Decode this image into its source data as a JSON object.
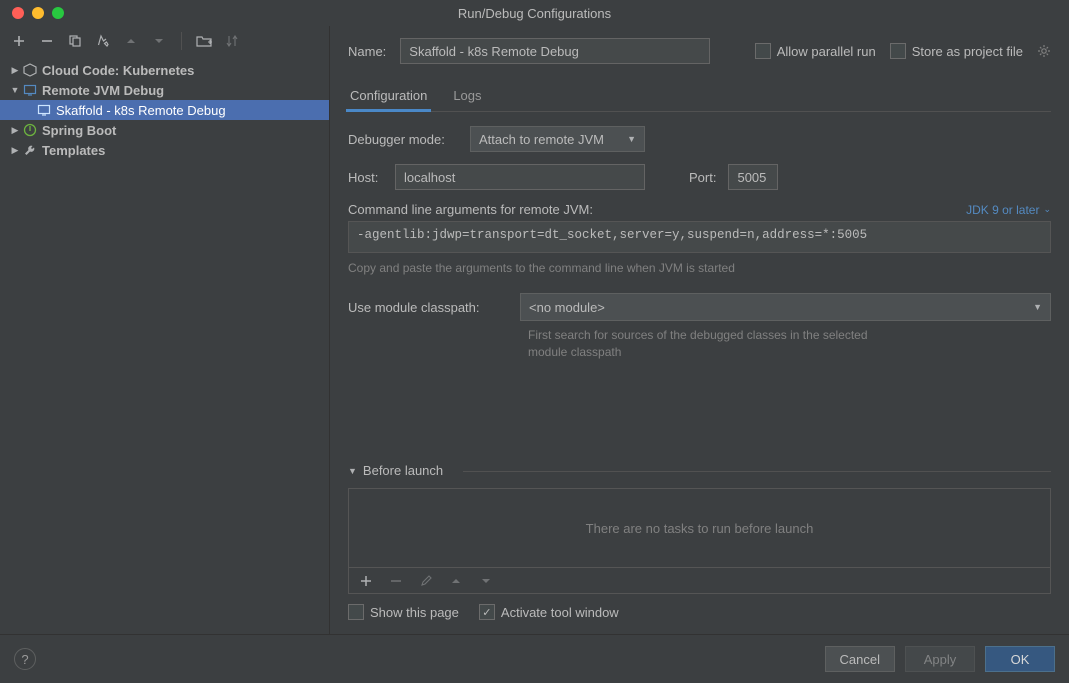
{
  "window": {
    "title": "Run/Debug Configurations"
  },
  "sidebar": {
    "items": [
      {
        "label": "Cloud Code: Kubernetes"
      },
      {
        "label": "Remote JVM Debug"
      },
      {
        "label": "Skaffold - k8s Remote Debug"
      },
      {
        "label": "Spring Boot"
      },
      {
        "label": "Templates"
      }
    ]
  },
  "form": {
    "name_label": "Name:",
    "name_value": "Skaffold - k8s Remote Debug",
    "allow_parallel": "Allow parallel run",
    "store_project": "Store as project file",
    "tabs": {
      "configuration": "Configuration",
      "logs": "Logs"
    },
    "debugger_mode_label": "Debugger mode:",
    "debugger_mode_value": "Attach to remote JVM",
    "host_label": "Host:",
    "host_value": "localhost",
    "port_label": "Port:",
    "port_value": "5005",
    "cmd_label": "Command line arguments for remote JVM:",
    "jdk_link": "JDK 9 or later",
    "cmd_value": "-agentlib:jdwp=transport=dt_socket,server=y,suspend=n,address=*:5005",
    "cmd_help": "Copy and paste the arguments to the command line when JVM is started",
    "module_label": "Use module classpath:",
    "module_value": "<no module>",
    "module_help": "First search for sources of the debugged classes in the selected module classpath",
    "before_launch_title": "Before launch",
    "no_tasks": "There are no tasks to run before launch",
    "show_this_page": "Show this page",
    "activate_tool_window": "Activate tool window"
  },
  "footer": {
    "cancel": "Cancel",
    "apply": "Apply",
    "ok": "OK"
  }
}
